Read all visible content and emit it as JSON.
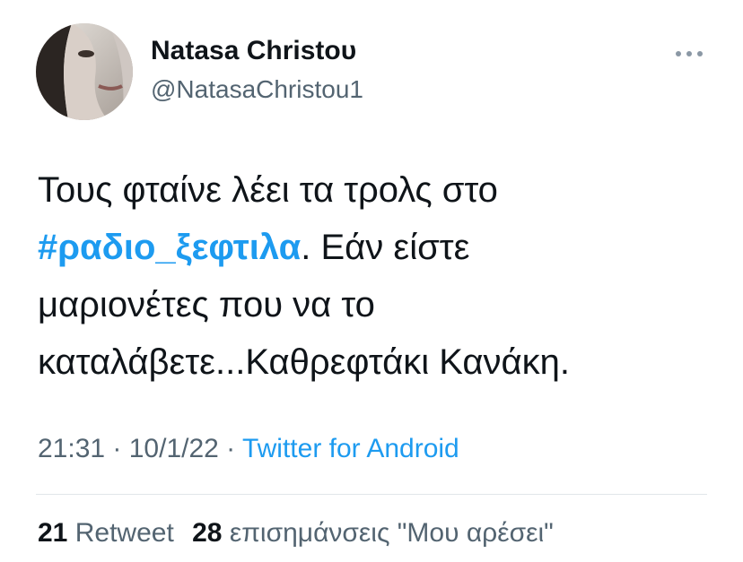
{
  "tweet": {
    "author": {
      "display_name": "Natasa Christου",
      "handle": "@NatasaChristou1"
    },
    "more_icon": "more-horizontal-icon",
    "text": {
      "line1": "Τους φταίνε λέει τα τρολς στο",
      "hashtag": "#ραδιο_ξεφτιλα",
      "line2_rest": ". Εάν είστε",
      "line3": "μαριονέτες που να το",
      "line4": "καταλάβετε...Καθρεφτάκι Κανάκη."
    },
    "meta": {
      "time": "21:31",
      "separator1": " · ",
      "date": "10/1/22",
      "separator2": " · ",
      "source": "Twitter for Android"
    },
    "stats": {
      "retweets_count": "21",
      "retweets_label": "Retweet",
      "likes_count": "28",
      "likes_label": "επισημάνσεις \"Μου αρέσει\""
    },
    "colors": {
      "link": "#1d9bf0",
      "text": "#0f1419",
      "secondary": "#536471",
      "divider": "#e1e6ea"
    }
  }
}
